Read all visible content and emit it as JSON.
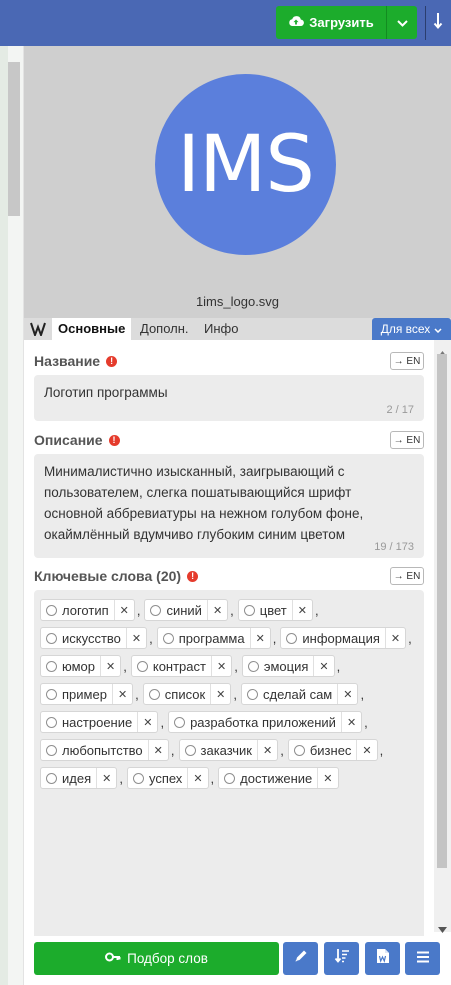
{
  "toolbar": {
    "upload_label": "Загрузить",
    "icons": {
      "upload": "cloud-upload-icon",
      "caret": "chevron-down-icon",
      "download": "arrow-down-icon"
    }
  },
  "preview": {
    "logo_text": "IMS",
    "filename": "1ims_logo.svg",
    "logo_color": "#5b7fdc"
  },
  "tabs": [
    {
      "label": "Основные",
      "active": true
    },
    {
      "label": "Дополн.",
      "active": false
    },
    {
      "label": "Инфо",
      "active": false
    }
  ],
  "for_all_label": "Для всех",
  "fields": {
    "title": {
      "label": "Название",
      "value": "Логотип программы",
      "counter": "2 / 17",
      "en_label": "→ EN"
    },
    "description": {
      "label": "Описание",
      "value": "Минималистично изысканный, заигрывающий с пользователем, слегка пошатывающийся шрифт основной аббревиатуры на нежном голубом фоне, окаймлённый вдумчиво глубоким синим цветом",
      "counter": "19 / 173",
      "en_label": "→ EN"
    },
    "keywords": {
      "label": "Ключевые слова (20)",
      "en_label": "→ EN",
      "items": [
        "логотип",
        "синий",
        "цвет",
        "искусство",
        "программа",
        "информация",
        "юмор",
        "контраст",
        "эмоция",
        "пример",
        "список",
        "сделай сам",
        "настроение",
        "разработка приложений",
        "любопытство",
        "заказчик",
        "бизнес",
        "идея",
        "успех",
        "достижение"
      ]
    }
  },
  "bottom": {
    "suggest_label": "Подбор слов",
    "icons": [
      "key-icon",
      "pencil-icon",
      "sort-icon",
      "word-export-icon",
      "menu-icon"
    ]
  },
  "colors": {
    "accent_green": "#1cac2c",
    "accent_blue": "#4a79c9",
    "header_blue": "#4a68b4",
    "warning_red": "#e53b2c"
  }
}
